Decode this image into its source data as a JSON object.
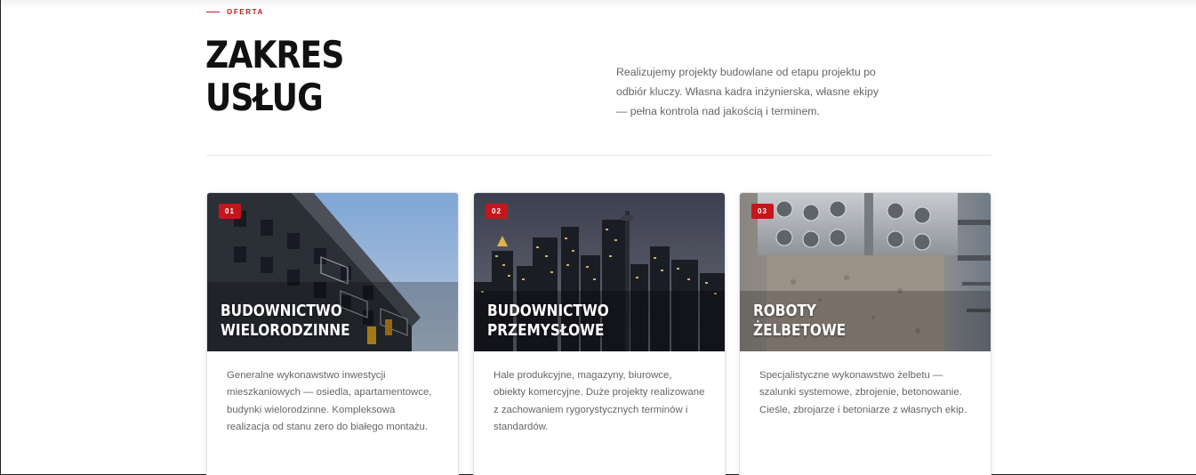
{
  "section": {
    "eyebrow": "OFERTA",
    "title_line1": "ZAKRES",
    "title_line2": "USŁUG",
    "intro": "Realizujemy projekty budowlane od etapu projektu po odbiór kluczy. Własna kadra inżynierska, własne ekipy — pełna kontrola nad jakością i terminem."
  },
  "colors": {
    "accent": "#c4161c",
    "heading": "#111111",
    "body_text": "#666666"
  },
  "cards": [
    {
      "number": "01",
      "title_line1": "BUDOWNICTWO",
      "title_line2": "WIELORODZINNE",
      "image": "residential-building-photo",
      "description": "Generalne wykonawstwo inwestycji mieszkaniowych — osiedla, apartamentowce, budynki wielorodzinne. Kompleksowa realizacja od stanu zero do białego montażu."
    },
    {
      "number": "02",
      "title_line1": "BUDOWNICTWO",
      "title_line2": "PRZEMYSŁOWE",
      "image": "city-skyline-photo",
      "description": "Hale produkcyjne, magazyny, biurowce, obiekty komercyjne. Duże projekty realizowane z zachowaniem rygorystycznych terminów i standardów."
    },
    {
      "number": "03",
      "title_line1": "ROBOTY",
      "title_line2": "ŻELBETOWE",
      "image": "concrete-steel-column-photo",
      "description": "Specjalistyczne wykonawstwo żelbetu — szalunki systemowe, zbrojenie, betonowanie. Cieśle, zbrojarze i betoniarze z własnych ekip."
    }
  ]
}
